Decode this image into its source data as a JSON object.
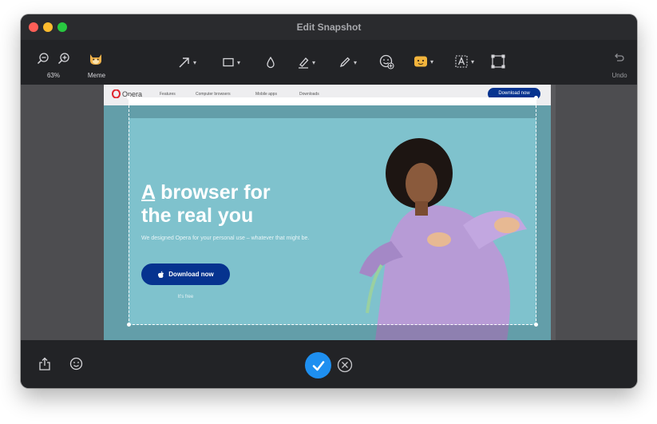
{
  "window": {
    "title": "Edit Snapshot"
  },
  "toolbar": {
    "zoom_level": "63%",
    "meme_label": "Meme",
    "undo_label": "Undo",
    "tools": [
      "arrow-tool",
      "rectangle-tool",
      "blur-tool",
      "highlighter-tool",
      "pen-tool",
      "emoji-sticker-tool",
      "sticker-tool",
      "text-tool",
      "crop-tool"
    ]
  },
  "snapshot": {
    "logo_text": "Opera",
    "nav_links": [
      "Features",
      "Computer browsers",
      "Mobile apps",
      "Downloads"
    ],
    "top_download_label": "Download now",
    "hero_title_line1_underlined": "A",
    "hero_title_line1_rest": " browser for",
    "hero_title_line2": "the real you",
    "hero_subtitle": "We designed Opera for your personal use – whatever that might be.",
    "hero_button_label": "Download now",
    "hero_free_text": "It's free",
    "hero_background": "#7fc2cd",
    "button_color": "#06338f"
  },
  "bottom": {
    "confirm_color": "#1e8ff0"
  }
}
